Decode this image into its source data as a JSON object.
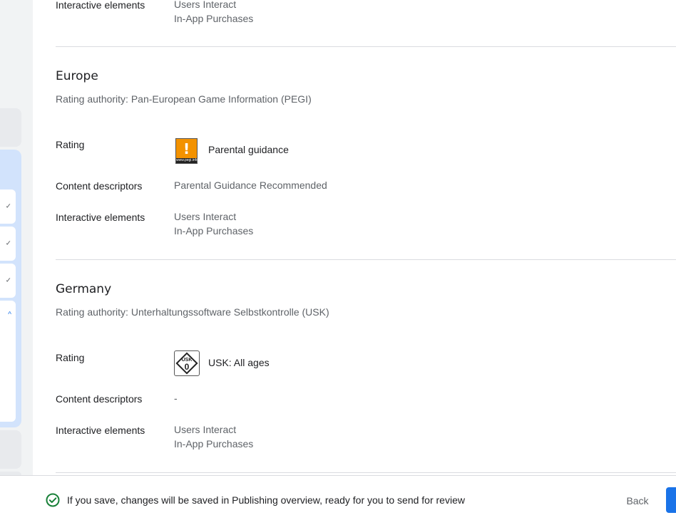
{
  "top_partial": {
    "label": "Interactive elements",
    "values": [
      "Users Interact",
      "In-App Purchases"
    ]
  },
  "sections": [
    {
      "region": "Europe",
      "authority": "Rating authority: Pan-European Game Information (PEGI)",
      "rating_label": "Rating",
      "rating_value": "Parental guidance",
      "badge_mark": "!",
      "badge_strip": "www.pegi.info",
      "content_label": "Content descriptors",
      "content_value": "Parental Guidance Recommended",
      "interactive_label": "Interactive elements",
      "interactive_values": [
        "Users Interact",
        "In-App Purchases"
      ]
    },
    {
      "region": "Germany",
      "authority": "Rating authority: Unterhaltungssoftware Selbstkontrolle (USK)",
      "rating_label": "Rating",
      "rating_value": "USK: All ages",
      "badge_top": "USK",
      "badge_num": "0",
      "content_label": "Content descriptors",
      "content_value": "-",
      "interactive_label": "Interactive elements",
      "interactive_values": [
        "Users Interact",
        "In-App Purchases"
      ]
    }
  ],
  "footer": {
    "message": "If you save, changes will be saved in Publishing overview, ready for you to send for review",
    "back_label": "Back"
  },
  "colors": {
    "accent": "#1a73e8",
    "success": "#188038",
    "pegi_orange": "#f39200"
  },
  "icons": {
    "success": "check-circle-icon",
    "rail_collapsed": "check-icon",
    "rail_expanded": "chevron-up-icon"
  }
}
